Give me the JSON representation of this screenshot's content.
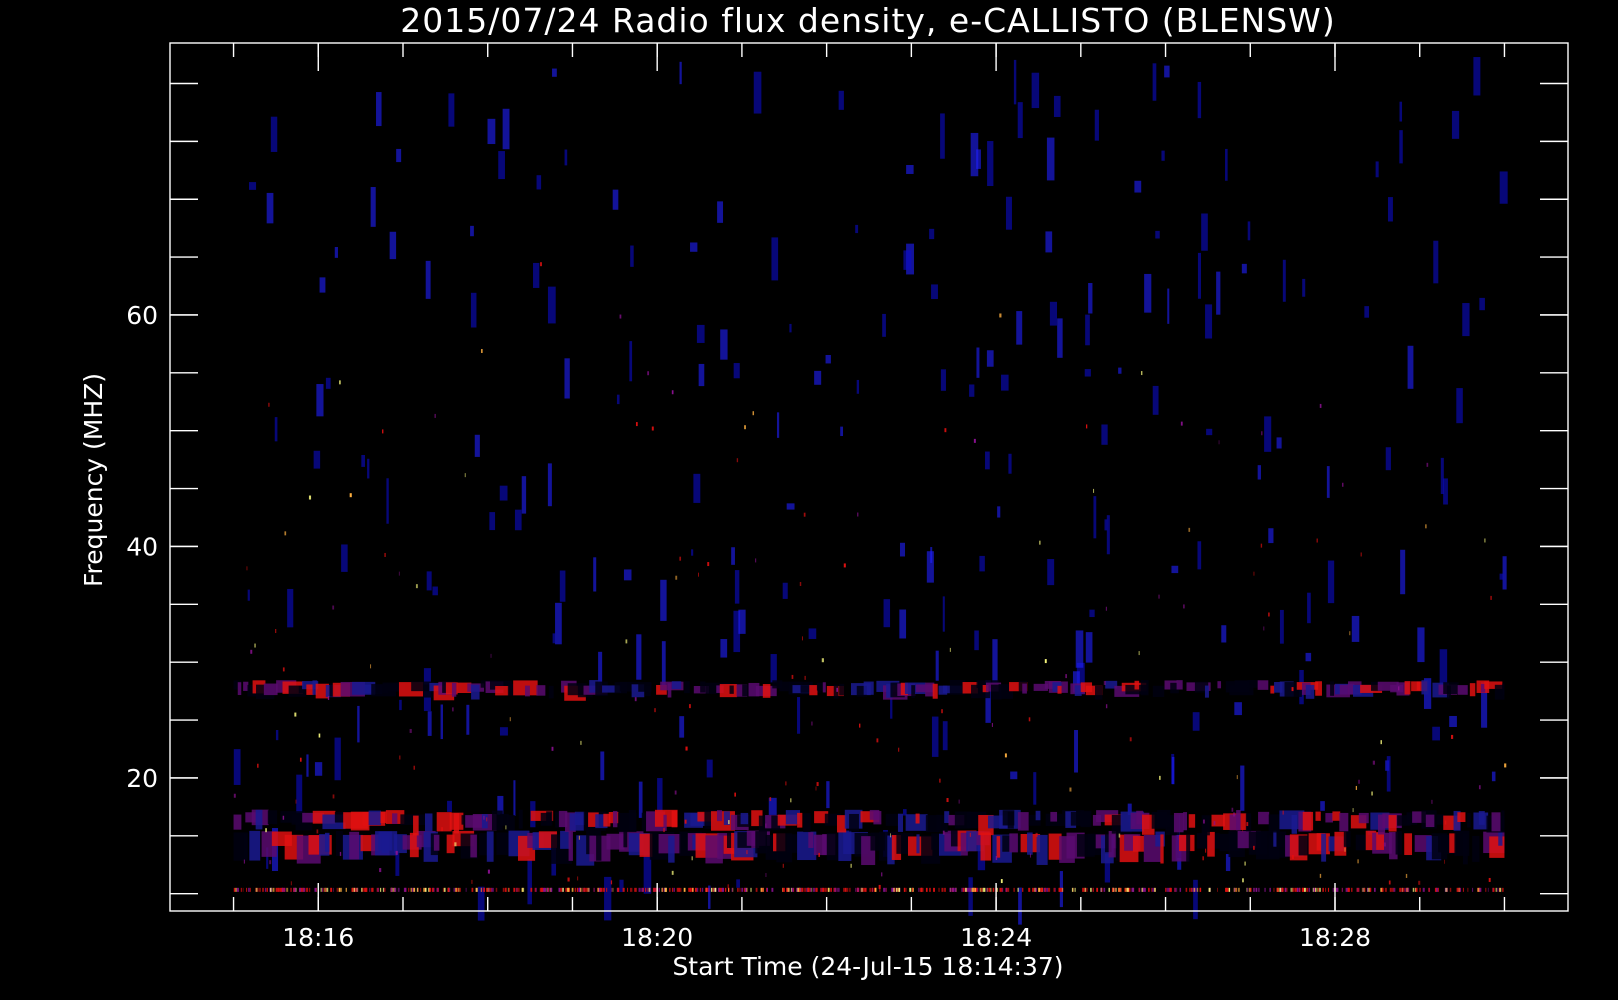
{
  "chart_data": {
    "type": "heatmap",
    "title": "2015/07/24  Radio flux density, e-CALLISTO (BLENSW)",
    "xlabel": "Start Time (24-Jul-15 18:14:37)",
    "ylabel": "Frequency (MHZ)",
    "x_tick_labels": [
      "18:16",
      "18:20",
      "18:24",
      "18:28"
    ],
    "x_tick_minutes": [
      16,
      20,
      24,
      28
    ],
    "y_tick_labels": [
      "20",
      "40",
      "60"
    ],
    "y_tick_values": [
      20,
      40,
      60
    ],
    "xlim_minutes": [
      14.25,
      30.75
    ],
    "ylim": [
      83.5,
      8.5
    ],
    "data_xrange_minutes": [
      15.0,
      30.0
    ],
    "data_yrange": [
      10.5,
      82.3
    ],
    "colors": {
      "background": "#000000",
      "axes": "#ffffff",
      "base": "#1010f0",
      "low": "#000010",
      "high": "#e01010",
      "peak": "#ffff80"
    }
  }
}
